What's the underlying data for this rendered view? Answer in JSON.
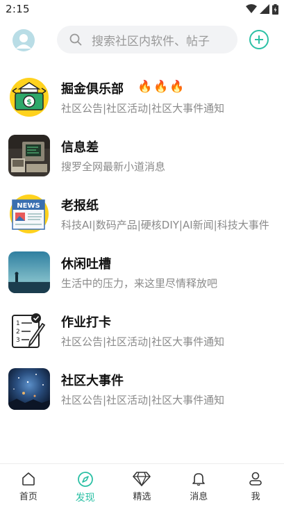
{
  "status_bar": {
    "time": "2:15"
  },
  "header": {
    "search_placeholder": "搜索社区内软件、帖子",
    "accent_color": "#2cc0a5"
  },
  "communities": [
    {
      "title": "掘金俱乐部",
      "desc": "社区公告|社区活动|社区大事件通知",
      "badge": "🔥🔥🔥",
      "icon": "money-bank-icon"
    },
    {
      "title": "信息差",
      "desc": "搜罗全网最新小道消息",
      "icon": "retro-computer-icon"
    },
    {
      "title": "老报纸",
      "desc": "科技AI|数码产品|硬核DIY|AI新闻|科技大事件",
      "icon": "news-icon"
    },
    {
      "title": "休闲吐槽",
      "desc": "生活中的压力，来这里尽情释放吧",
      "icon": "sunset-scene-icon"
    },
    {
      "title": "作业打卡",
      "desc": "社区公告|社区活动|社区大事件通知",
      "icon": "checklist-icon"
    },
    {
      "title": "社区大事件",
      "desc": "社区公告|社区活动|社区大事件通知",
      "icon": "night-sky-icon"
    }
  ],
  "tabbar": {
    "items": [
      {
        "label": "首页",
        "icon": "home-icon"
      },
      {
        "label": "发现",
        "icon": "compass-icon",
        "active": true
      },
      {
        "label": "精选",
        "icon": "diamond-icon"
      },
      {
        "label": "消息",
        "icon": "bell-icon"
      },
      {
        "label": "我",
        "icon": "person-icon"
      }
    ]
  }
}
